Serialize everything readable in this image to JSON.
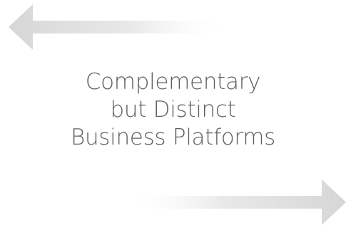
{
  "headline": {
    "lines": [
      "Complementary",
      "but Distinct",
      "Business Platforms"
    ]
  },
  "arrows": {
    "top": {
      "direction": "left",
      "icon": "arrow-left-icon"
    },
    "bottom": {
      "direction": "right",
      "icon": "arrow-right-icon"
    }
  },
  "colors": {
    "text": "#5f5f5f",
    "arrow": "#dcdcdc",
    "background": "#ffffff"
  }
}
